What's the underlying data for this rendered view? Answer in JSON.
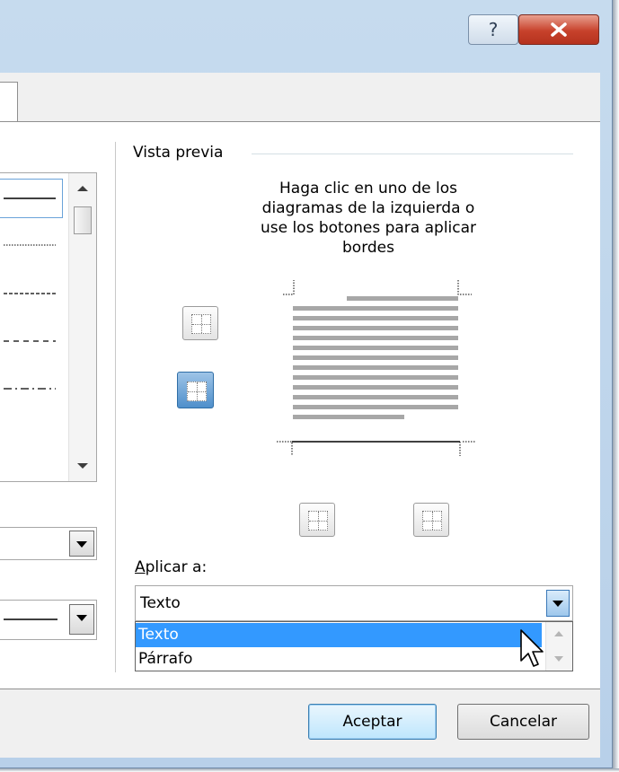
{
  "titlebar": {
    "help_glyph": "?",
    "close_glyph": "X"
  },
  "preview": {
    "section_label": "Vista previa",
    "help_lines": [
      "Haga clic en uno de los",
      "diagramas de la izquierda o",
      "use los botones para aplicar",
      "bordes"
    ]
  },
  "apply": {
    "label_underlined": "A",
    "label_rest": "plicar a:",
    "selected_value": "Texto",
    "options": [
      "Texto",
      "Párrafo"
    ],
    "highlighted_option": "Texto"
  },
  "buttons": {
    "ok": "Aceptar",
    "cancel": "Cancelar"
  },
  "colors": {
    "highlight": "#3399ff",
    "close_button": "#c7412b",
    "title_bar": "#c6dbee"
  }
}
